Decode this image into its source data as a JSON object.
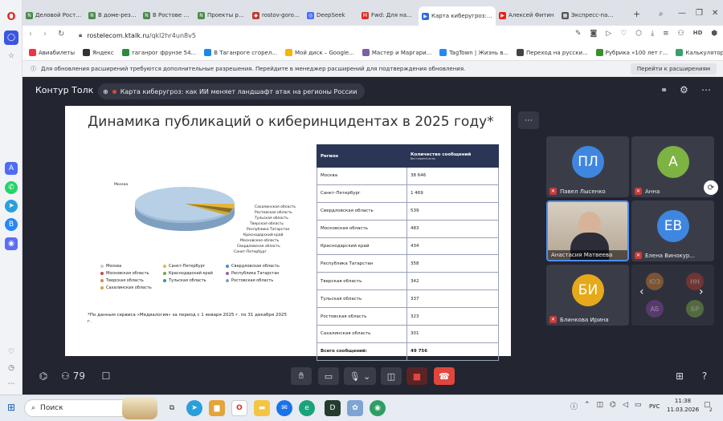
{
  "browser": {
    "tabs": [
      {
        "label": "Деловой Ростов",
        "fav": "N",
        "color": "#4a8a4a"
      },
      {
        "label": "В доме-резиденции",
        "fav": "N",
        "color": "#4a8a4a"
      },
      {
        "label": "В Ростове заработ",
        "fav": "N",
        "color": "#4a8a4a"
      },
      {
        "label": "Проекты ростовс",
        "fav": "N",
        "color": "#4a8a4a"
      },
      {
        "label": "rostov-gorod.ru",
        "fav": "◆",
        "color": "#c0392b"
      },
      {
        "label": "DeepSeek",
        "fav": "◎",
        "color": "#4a6cf7"
      },
      {
        "label": "Fwd: Для написан",
        "fav": "M",
        "color": "#d93025"
      },
      {
        "label": "Карта киберугроз: ка",
        "fav": "▶",
        "color": "#2d6be4"
      },
      {
        "label": "Алексей Фитин",
        "fav": "▶",
        "color": "#e62117"
      },
      {
        "label": "Экспресс-панель",
        "fav": "▦",
        "color": "#555"
      }
    ],
    "new_tab": "+",
    "url_domain": "rostelecom.ktalk.ru",
    "url_path": "/qkl2hr4un8v5",
    "bookmarks": [
      "Авиабилеты",
      "Яндекс",
      "таганрог фрунзе 54...",
      "В Таганроге сгорел...",
      "Мой диск – Google...",
      "Мастер и Маргари...",
      "TagTown | Жизнь в...",
      "Переход на русски...",
      "Рубрика «100 лет г...",
      "Калькулятор расче..."
    ],
    "ext_notice": "Для обновления расширений требуются дополнительные разрешения. Перейдите в менеджер расширений для подтверждения обновления.",
    "ext_button": "Перейти к расширениям"
  },
  "app": {
    "brand": "Контур Толк",
    "meeting_title": "Карта киберугроз: как ИИ меняет ландшафт атак на регионы России",
    "participants_count": "79"
  },
  "slide": {
    "title": "Динамика публикаций о киберинцидентах в 2025 году*",
    "footnote": "*По данным сервиса «Медиалогия» за период с 1 января 2025 г. по 31 декабря 2025 г.",
    "pie_labels": [
      "Москва",
      "Сахалинская область",
      "Ростовская область",
      "Тульская область",
      "Тверская область",
      "Республика Татарстан",
      "Краснодарский край",
      "Московская область",
      "Свердловская область",
      "Санкт-Петербург"
    ],
    "legend": [
      "Москва",
      "Санкт-Петербург",
      "Свердловская область",
      "Московская область",
      "Краснодарский край",
      "Республика Татарстан",
      "Тверская область",
      "Тульская область",
      "Ростовская область",
      "Сахалинская область"
    ],
    "table_header": {
      "region": "Регион",
      "count": "Количество сообщений",
      "count_sub": "без перепечаток"
    },
    "rows": [
      {
        "region": "Москва",
        "count": "38 646"
      },
      {
        "region": "Санкт-Петербург",
        "count": "1 469"
      },
      {
        "region": "Свердловская область",
        "count": "539"
      },
      {
        "region": "Московская область",
        "count": "483"
      },
      {
        "region": "Краснодарский край",
        "count": "434"
      },
      {
        "region": "Республика Татарстан",
        "count": "358"
      },
      {
        "region": "Тверская область",
        "count": "342"
      },
      {
        "region": "Тульская область",
        "count": "337"
      },
      {
        "region": "Ростовская область",
        "count": "323"
      },
      {
        "region": "Сахалинская область",
        "count": "301"
      }
    ],
    "total": {
      "label": "Всего сообщений:",
      "count": "49 756"
    }
  },
  "participants": [
    {
      "initials": "ПЛ",
      "name": "Павел Лысенко",
      "color": "#3f86e0"
    },
    {
      "initials": "А",
      "name": "Анна",
      "color": "#7cb342"
    },
    {
      "initials": "",
      "name": "Анастасия Матвеева",
      "color": "#6a5a4a"
    },
    {
      "initials": "ЕВ",
      "name": "Елена Винокур...",
      "color": "#3f86e0"
    },
    {
      "initials": "БИ",
      "name": "Блинкова Ирина",
      "color": "#e5a91a"
    }
  ],
  "mini_avatars": [
    {
      "initials": "ЮЭ",
      "color": "#d9822b"
    },
    {
      "initials": "НН",
      "color": "#c0392b"
    },
    {
      "initials": "АБ",
      "color": "#8e44ad"
    },
    {
      "initials": "БР",
      "color": "#7cb342"
    }
  ],
  "taskbar": {
    "search": "Поиск",
    "lang": "РУС",
    "time": "11:38",
    "date": "11.03.2026",
    "notif": "2"
  }
}
